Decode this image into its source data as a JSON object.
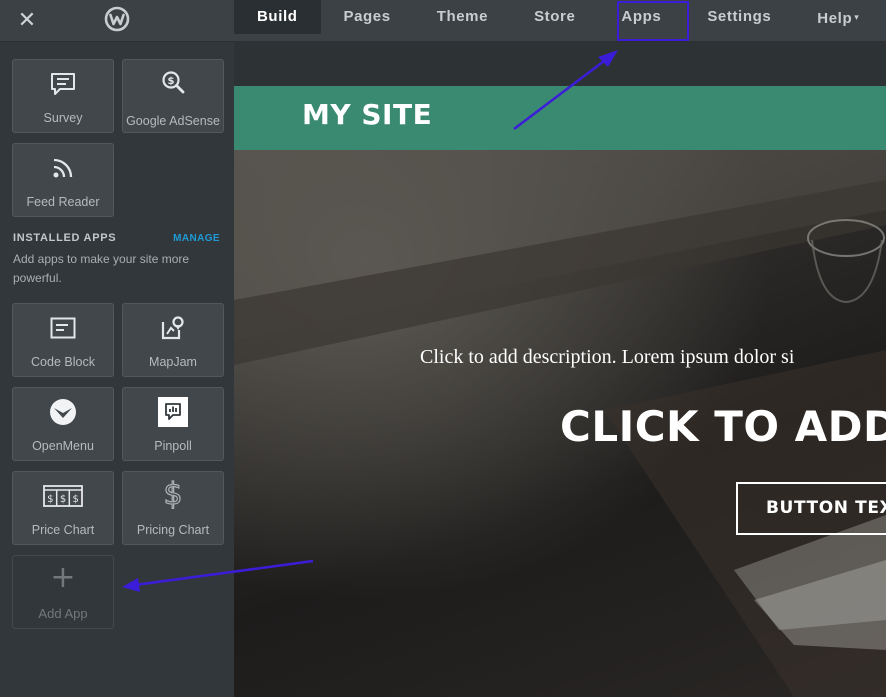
{
  "topbar": {
    "close_icon": "close-icon",
    "logo_icon": "weebly-logo-icon",
    "nav": [
      {
        "label": "Build",
        "active": true
      },
      {
        "label": "Pages",
        "active": false
      },
      {
        "label": "Theme",
        "active": false
      },
      {
        "label": "Store",
        "active": false
      },
      {
        "label": "Apps",
        "active": false
      },
      {
        "label": "Settings",
        "active": false
      },
      {
        "label": "Help",
        "active": false
      }
    ],
    "highlighted_item": "Apps"
  },
  "sidebar": {
    "top_apps": [
      {
        "label": "Survey",
        "icon": "survey-icon"
      },
      {
        "label": "Google AdSense",
        "icon": "adsense-icon"
      },
      {
        "label": "Feed Reader",
        "icon": "rss-icon"
      }
    ],
    "installed_title": "INSTALLED APPS",
    "manage_label": "MANAGE",
    "installed_desc": "Add apps to make your site more powerful.",
    "installed_apps": [
      {
        "label": "Code Block",
        "icon": "code-block-icon"
      },
      {
        "label": "MapJam",
        "icon": "mapjam-icon"
      },
      {
        "label": "OpenMenu",
        "icon": "openmenu-icon"
      },
      {
        "label": "Pinpoll",
        "icon": "pinpoll-icon"
      },
      {
        "label": "Price Chart",
        "icon": "price-chart-icon"
      },
      {
        "label": "Pricing Chart",
        "icon": "dollar-icon"
      }
    ],
    "add_app": {
      "label": "Add App",
      "symbol": "+"
    }
  },
  "canvas": {
    "site_title": "MY SITE",
    "hero_description": "Click to add description. Lorem ipsum dolor si",
    "hero_headline": "CLICK TO ADD H",
    "hero_button": "BUTTON TEXT"
  },
  "colors": {
    "annotation": "#3b1dd9",
    "header_green": "#3a8a72",
    "manage_link": "#1e9bd7"
  }
}
